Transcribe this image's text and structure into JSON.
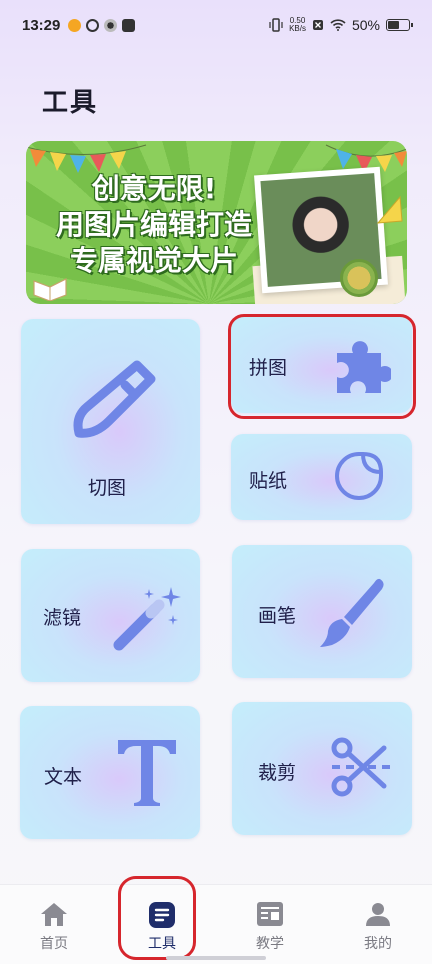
{
  "status_bar": {
    "time": "13:29",
    "net_speed_value": "0.50",
    "net_speed_unit": "KB/s",
    "battery_percent": "50%",
    "battery_level": 0.5
  },
  "page": {
    "title": "工具"
  },
  "banner": {
    "line1": "创意无限!",
    "line2": "用图片编辑打造",
    "line3": "专属视觉大片"
  },
  "tools": [
    {
      "id": "cut",
      "label": "切图",
      "icon": "knife-icon"
    },
    {
      "id": "collage",
      "label": "拼图",
      "icon": "puzzle-icon",
      "highlighted": true
    },
    {
      "id": "sticker",
      "label": "贴纸",
      "icon": "sticker-icon"
    },
    {
      "id": "filter",
      "label": "滤镜",
      "icon": "magic-wand-icon"
    },
    {
      "id": "brush",
      "label": "画笔",
      "icon": "brush-icon"
    },
    {
      "id": "text",
      "label": "文本",
      "icon": "text-t-icon"
    },
    {
      "id": "crop",
      "label": "裁剪",
      "icon": "scissors-icon"
    }
  ],
  "bottom_nav": {
    "items": [
      {
        "label": "首页",
        "icon": "home-icon"
      },
      {
        "label": "工具",
        "icon": "tools-icon",
        "active": true
      },
      {
        "label": "教学",
        "icon": "tutorial-icon"
      },
      {
        "label": "我的",
        "icon": "profile-icon"
      }
    ]
  },
  "colors": {
    "accent": "#6f86e6",
    "highlight_border": "#d6262d",
    "active_nav": "#1f2d6a"
  }
}
